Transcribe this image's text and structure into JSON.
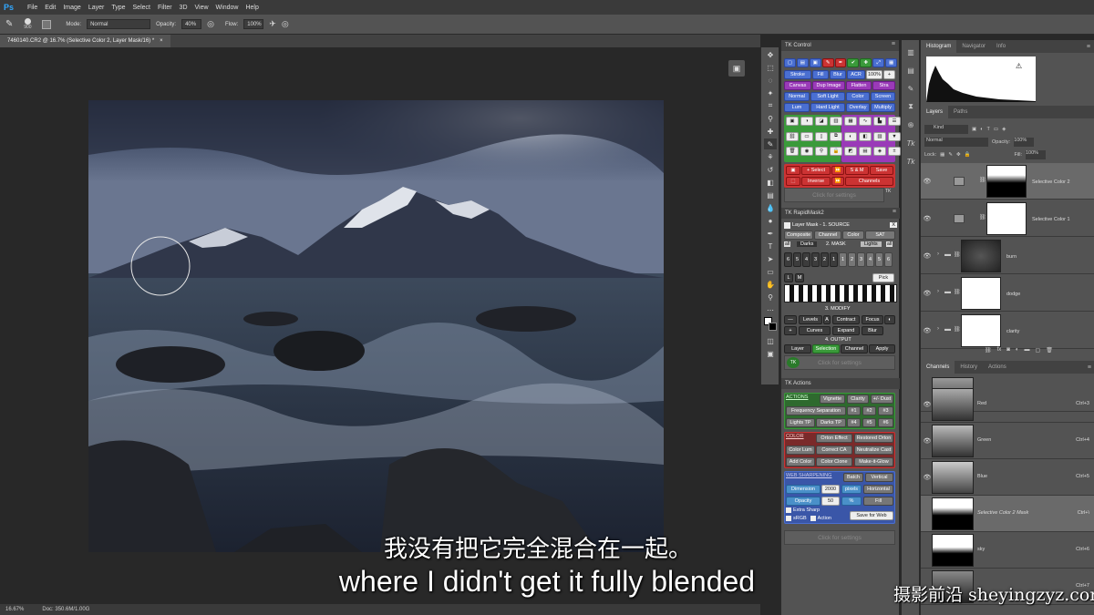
{
  "app": {
    "logo": "Ps"
  },
  "menu": [
    "File",
    "Edit",
    "Image",
    "Layer",
    "Type",
    "Select",
    "Filter",
    "3D",
    "View",
    "Window",
    "Help"
  ],
  "options": {
    "brush_size": "900",
    "mode_label": "Mode:",
    "mode_value": "Normal",
    "opacity_label": "Opacity:",
    "opacity_value": "40%",
    "flow_label": "Flow:",
    "flow_value": "100%"
  },
  "document": {
    "tab_title": "7460140.CR2 @ 16.7% (Selective Color 2, Layer Mask/16) *",
    "zoom": "16.67%",
    "doc_info": "Doc: 350.6M/1.00G"
  },
  "tk_control": {
    "title": "TK Control",
    "row1": [
      "Stroke",
      "Fill",
      "Blur",
      "ACR",
      "100%"
    ],
    "row2": [
      "Canvas",
      "Dup Image",
      "Flatten",
      "Stra"
    ],
    "row3": [
      "Normal",
      "Soft Light",
      "Color",
      "Screen"
    ],
    "row4": [
      "Lum",
      "Hard Light",
      "Overlay",
      "Multiply"
    ],
    "select_row": [
      "+ Select",
      "S & M",
      "Save"
    ],
    "inverse_row": [
      "Inverse",
      "Channels"
    ],
    "click_settings": "Click for settings"
  },
  "tk_rapidmask": {
    "title": "TK RapidMask2",
    "layer_mask_label": "Layer Mask - 1. SOURCE",
    "source_buttons": [
      "Composite",
      "Channel",
      "Color",
      "SAT"
    ],
    "darks": "Darks",
    "mask_label": "2. MASK",
    "lights": "Lights",
    "number_row": [
      "6",
      "5",
      "4",
      "3",
      "2",
      "1",
      "1",
      "2",
      "3",
      "4",
      "5",
      "6"
    ],
    "pick": "Pick",
    "modify_label": "3. MODIFY",
    "modify_row1": [
      "Levels",
      "A",
      "Contract",
      "Focus"
    ],
    "modify_row2": [
      "Curves",
      "Expand",
      "Blur"
    ],
    "output_label": "4. OUTPUT",
    "output_row": [
      "Layer",
      "Selection",
      "Channel",
      "Apply"
    ],
    "click_settings": "Click for settings"
  },
  "tk_actions": {
    "title": "TK Actions",
    "actions_label": "ACTIONS",
    "actions_btns": [
      "Vignette",
      "Clarity",
      "+/- Dust"
    ],
    "freq": "Frequency Separation",
    "freq_nums": [
      "#1",
      "#2",
      "#3"
    ],
    "lights_tp": "Lights TP",
    "darks_tp": "Darks TP",
    "tp_nums": [
      "#4",
      "#5",
      "#6"
    ],
    "color_label": "COLOR",
    "color_btns": [
      "Orton Effect",
      "Restored Orton",
      "Color Lum",
      "Correct CA",
      "Neutralize Cast",
      "Add Color",
      "Color Clone",
      "Make-it-Glow"
    ],
    "web_label": "WEB SHARPENING",
    "web_btns": [
      "Batch",
      "Vertical"
    ],
    "dimension": "Dimension",
    "dimension_value": "2000",
    "pixels": "pixels",
    "horizontal": "Horizontal",
    "opacity": "Opacity",
    "opacity_value": "50",
    "pct": "%",
    "fill": "Fill",
    "extra_sharp": "Extra Sharp",
    "srgb": "sRGB",
    "action": "Action",
    "save_web": "Save for Web",
    "click_settings": "Click for settings"
  },
  "right_panel": {
    "top_tabs": [
      "Histogram",
      "Navigator",
      "Info"
    ],
    "layer_tabs": [
      "Layers",
      "Paths"
    ],
    "kind": "Kind",
    "blend_mode": "Normal",
    "opacity_label": "Opacity:",
    "opacity_value": "100%",
    "lock_label": "Lock:",
    "fill_label": "Fill:",
    "fill_value": "100%",
    "layers": [
      {
        "name": "Selective Color 2"
      },
      {
        "name": "Selective Color 1"
      },
      {
        "name": "burn"
      },
      {
        "name": "dodge"
      },
      {
        "name": "clarity"
      }
    ],
    "channel_tabs": [
      "Channels",
      "History",
      "Actions"
    ],
    "channels": [
      {
        "name": "Red",
        "key": "Ctrl+3"
      },
      {
        "name": "Green",
        "key": "Ctrl+4"
      },
      {
        "name": "Blue",
        "key": "Ctrl+5"
      },
      {
        "name": "Selective Color 2 Mask",
        "key": "Ctrl+\\"
      },
      {
        "name": "sky",
        "key": "Ctrl+6"
      },
      {
        "name": "",
        "key": "Ctrl+7"
      }
    ]
  },
  "subtitles": {
    "cn": "我没有把它完全混合在一起。",
    "en": "where I didn't get it fully blended"
  },
  "watermark": "摄影前沿 sheyingzyz.com"
}
